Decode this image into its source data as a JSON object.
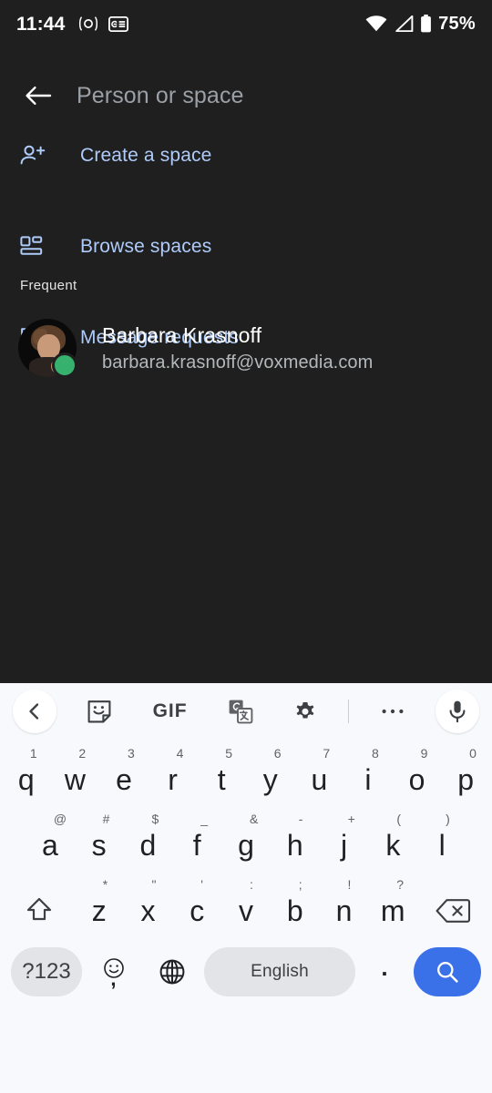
{
  "status_bar": {
    "time": "11:44",
    "battery_percent": "75%",
    "icons": [
      "record-indicator-icon",
      "google-pay-card-icon",
      "wifi-icon",
      "cellular-signal-icon",
      "battery-icon"
    ]
  },
  "search_header": {
    "back_icon": "arrow-back-icon",
    "placeholder": "Person or space",
    "value": ""
  },
  "actions": [
    {
      "label": "Create a space",
      "icon": "person-add-icon"
    },
    {
      "label": "Browse spaces",
      "icon": "grid-spaces-icon"
    },
    {
      "label": "Message requests",
      "icon": "message-request-icon"
    }
  ],
  "frequent": {
    "section_label": "Frequent",
    "contacts": [
      {
        "name": "Barbara Krasnoff",
        "email": "barbara.krasnoff@voxmedia.com",
        "presence": "available",
        "presence_color": "#37b26e"
      }
    ]
  },
  "keyboard": {
    "toolbar": [
      {
        "name": "expand-toolbar-back-icon",
        "glyph": "chevron-left-icon"
      },
      {
        "name": "sticker-icon",
        "glyph": "sticker-icon"
      },
      {
        "name": "gif-button",
        "label": "GIF"
      },
      {
        "name": "translate-icon",
        "glyph": "google-translate-icon"
      },
      {
        "name": "settings-gear-icon",
        "glyph": "gear-icon"
      },
      {
        "name": "more-options-icon",
        "glyph": "ellipsis-icon"
      },
      {
        "name": "voice-input-icon",
        "glyph": "microphone-icon"
      }
    ],
    "row1": [
      {
        "key": "q",
        "sup": "1"
      },
      {
        "key": "w",
        "sup": "2"
      },
      {
        "key": "e",
        "sup": "3"
      },
      {
        "key": "r",
        "sup": "4"
      },
      {
        "key": "t",
        "sup": "5"
      },
      {
        "key": "y",
        "sup": "6"
      },
      {
        "key": "u",
        "sup": "7"
      },
      {
        "key": "i",
        "sup": "8"
      },
      {
        "key": "o",
        "sup": "9"
      },
      {
        "key": "p",
        "sup": "0"
      }
    ],
    "row2": [
      {
        "key": "a",
        "sup": "@"
      },
      {
        "key": "s",
        "sup": "#"
      },
      {
        "key": "d",
        "sup": "$"
      },
      {
        "key": "f",
        "sup": "_"
      },
      {
        "key": "g",
        "sup": "&"
      },
      {
        "key": "h",
        "sup": "-"
      },
      {
        "key": "j",
        "sup": "+"
      },
      {
        "key": "k",
        "sup": "("
      },
      {
        "key": "l",
        "sup": ")"
      }
    ],
    "row3": [
      {
        "key": "z",
        "sup": "*"
      },
      {
        "key": "x",
        "sup": "\""
      },
      {
        "key": "c",
        "sup": "'"
      },
      {
        "key": "v",
        "sup": ":"
      },
      {
        "key": "b",
        "sup": ";"
      },
      {
        "key": "n",
        "sup": "!"
      },
      {
        "key": "m",
        "sup": "?"
      }
    ],
    "shift_icon": "shift-arrow-icon",
    "backspace_icon": "backspace-icon",
    "bottom": {
      "symbols_label": "?123",
      "emoji_icon": "emoji-smiley-icon",
      "comma_label": ",",
      "globe_icon": "language-globe-icon",
      "space_label": "English",
      "period_label": ".",
      "enter_icon": "search-magnifier-icon"
    }
  },
  "colors": {
    "app_background": "#1f1f1f",
    "accent_blue": "#aecbfa",
    "keyboard_background": "#f7f9fc",
    "enter_key": "#3b71e8",
    "key_surface": "#e2e4e8"
  }
}
